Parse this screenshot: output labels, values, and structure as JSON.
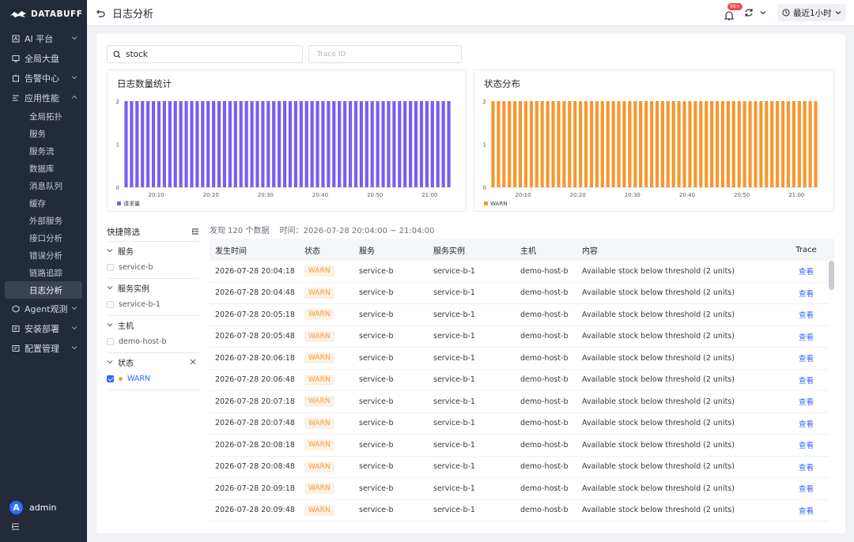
{
  "brand": {
    "name": "DATABUFF"
  },
  "header": {
    "title": "日志分析",
    "notification_badge": "99+",
    "time_range": "最近1小时"
  },
  "sidebar": {
    "groups": [
      {
        "label": "AI 平台",
        "icon": "ai-icon",
        "expandable": true
      },
      {
        "label": "全局大盘",
        "icon": "dashboard-icon",
        "expandable": false
      },
      {
        "label": "告警中心",
        "icon": "alert-icon",
        "expandable": true
      },
      {
        "label": "应用性能",
        "icon": "apm-icon",
        "expandable": true,
        "expanded": true
      }
    ],
    "apm_items": [
      "全局拓扑",
      "服务",
      "服务流",
      "数据库",
      "消息队列",
      "缓存",
      "外部服务",
      "接口分析",
      "错误分析",
      "链路追踪",
      "日志分析"
    ],
    "active_item": "日志分析",
    "bottom_groups": [
      {
        "label": "Agent观测",
        "icon": "agent-icon"
      },
      {
        "label": "安装部署",
        "icon": "install-icon"
      },
      {
        "label": "配置管理",
        "icon": "config-icon"
      }
    ],
    "user": {
      "initial": "A",
      "name": "admin"
    }
  },
  "search": {
    "value": "stock",
    "trace_placeholder": "Trace ID"
  },
  "filters": {
    "title": "快捷筛选",
    "groups": [
      {
        "label": "服务",
        "options": [
          {
            "label": "service-b",
            "checked": false
          }
        ]
      },
      {
        "label": "服务实例",
        "options": [
          {
            "label": "service-b-1",
            "checked": false
          }
        ]
      },
      {
        "label": "主机",
        "options": [
          {
            "label": "demo-host-b",
            "checked": false
          }
        ]
      },
      {
        "label": "状态",
        "options": [
          {
            "label": "WARN",
            "checked": true
          }
        ]
      }
    ]
  },
  "summary": {
    "text": "发现 120 个数据",
    "time_label": "时间：2026-07-28 20:04:00 ~ 21:04:00"
  },
  "table": {
    "columns": [
      "发生时间",
      "状态",
      "服务",
      "服务实例",
      "主机",
      "内容",
      "Trace"
    ],
    "rows": [
      {
        "time": "2026-07-28 20:04:18",
        "status": "WARN",
        "service": "service-b",
        "instance": "service-b-1",
        "host": "demo-host-b",
        "content": "Available stock below threshold (2 units)",
        "trace": "查看"
      },
      {
        "time": "2026-07-28 20:04:48",
        "status": "WARN",
        "service": "service-b",
        "instance": "service-b-1",
        "host": "demo-host-b",
        "content": "Available stock below threshold (2 units)",
        "trace": "查看"
      },
      {
        "time": "2026-07-28 20:05:18",
        "status": "WARN",
        "service": "service-b",
        "instance": "service-b-1",
        "host": "demo-host-b",
        "content": "Available stock below threshold (2 units)",
        "trace": "查看"
      },
      {
        "time": "2026-07-28 20:05:48",
        "status": "WARN",
        "service": "service-b",
        "instance": "service-b-1",
        "host": "demo-host-b",
        "content": "Available stock below threshold (2 units)",
        "trace": "查看"
      },
      {
        "time": "2026-07-28 20:06:18",
        "status": "WARN",
        "service": "service-b",
        "instance": "service-b-1",
        "host": "demo-host-b",
        "content": "Available stock below threshold (2 units)",
        "trace": "查看"
      },
      {
        "time": "2026-07-28 20:06:48",
        "status": "WARN",
        "service": "service-b",
        "instance": "service-b-1",
        "host": "demo-host-b",
        "content": "Available stock below threshold (2 units)",
        "trace": "查看"
      },
      {
        "time": "2026-07-28 20:07:18",
        "status": "WARN",
        "service": "service-b",
        "instance": "service-b-1",
        "host": "demo-host-b",
        "content": "Available stock below threshold (2 units)",
        "trace": "查看"
      },
      {
        "time": "2026-07-28 20:07:48",
        "status": "WARN",
        "service": "service-b",
        "instance": "service-b-1",
        "host": "demo-host-b",
        "content": "Available stock below threshold (2 units)",
        "trace": "查看"
      },
      {
        "time": "2026-07-28 20:08:18",
        "status": "WARN",
        "service": "service-b",
        "instance": "service-b-1",
        "host": "demo-host-b",
        "content": "Available stock below threshold (2 units)",
        "trace": "查看"
      },
      {
        "time": "2026-07-28 20:08:48",
        "status": "WARN",
        "service": "service-b",
        "instance": "service-b-1",
        "host": "demo-host-b",
        "content": "Available stock below threshold (2 units)",
        "trace": "查看"
      },
      {
        "time": "2026-07-28 20:09:18",
        "status": "WARN",
        "service": "service-b",
        "instance": "service-b-1",
        "host": "demo-host-b",
        "content": "Available stock below threshold (2 units)",
        "trace": "查看"
      },
      {
        "time": "2026-07-28 20:09:48",
        "status": "WARN",
        "service": "service-b",
        "instance": "service-b-1",
        "host": "demo-host-b",
        "content": "Available stock below threshold (2 units)",
        "trace": "查看"
      }
    ]
  },
  "chart_data": [
    {
      "type": "bar",
      "title": "日志数量统计",
      "color": "#7b5cf0",
      "ylim": [
        0,
        2
      ],
      "yticks": [
        "0",
        "1",
        "2"
      ],
      "xticks": [
        "20:10",
        "20:20",
        "20:30",
        "20:40",
        "20:50",
        "21:00"
      ],
      "series": [
        {
          "name": "请求量",
          "values": [
            2,
            2,
            2,
            2,
            2,
            2,
            2,
            2,
            2,
            2,
            2,
            2,
            2,
            2,
            2,
            2,
            2,
            2,
            2,
            2,
            2,
            2,
            2,
            2,
            2,
            2,
            2,
            2,
            2,
            2,
            2,
            2,
            2,
            2,
            2,
            2,
            2,
            2,
            2,
            2,
            2,
            2,
            2,
            2,
            2,
            2,
            2,
            2,
            2,
            2,
            2,
            2,
            2,
            2,
            2,
            2,
            2,
            2,
            2,
            2
          ]
        }
      ]
    },
    {
      "type": "bar",
      "title": "状态分布",
      "color": "#f5972e",
      "ylim": [
        0,
        2
      ],
      "yticks": [
        "0",
        "1",
        "2"
      ],
      "xticks": [
        "20:10",
        "20:20",
        "20:30",
        "20:40",
        "20:50",
        "21:00"
      ],
      "series": [
        {
          "name": "WARN",
          "values": [
            2,
            2,
            2,
            2,
            2,
            2,
            2,
            2,
            2,
            2,
            2,
            2,
            2,
            2,
            2,
            2,
            2,
            2,
            2,
            2,
            2,
            2,
            2,
            2,
            2,
            2,
            2,
            2,
            2,
            2,
            2,
            2,
            2,
            2,
            2,
            2,
            2,
            2,
            2,
            2,
            2,
            2,
            2,
            2,
            2,
            2,
            2,
            2,
            2,
            2,
            2,
            2,
            2,
            2,
            2,
            2,
            2,
            2,
            2,
            2
          ]
        }
      ]
    }
  ]
}
